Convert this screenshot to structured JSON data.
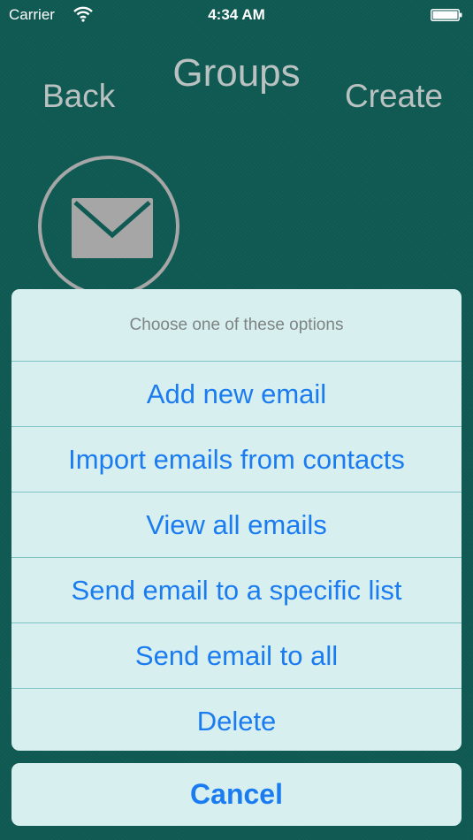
{
  "status_bar": {
    "carrier": "Carrier",
    "time": "4:34 AM",
    "wifi_icon": "wifi-icon",
    "battery_icon": "battery-icon"
  },
  "nav": {
    "back_label": "Back",
    "title": "Groups",
    "create_label": "Create"
  },
  "content": {
    "mail_icon": "envelope-icon"
  },
  "action_sheet": {
    "header": "Choose one of these options",
    "options": [
      "Add new email",
      "Import emails from contacts",
      "View all emails",
      "Send email to a specific list",
      "Send email to all",
      "Delete"
    ],
    "cancel_label": "Cancel"
  },
  "colors": {
    "background": "#0f5a53",
    "sheet": "#d8efef",
    "accent": "#1a7cf0",
    "nav_text": "#b9c2c0",
    "icon_gray": "#a6a6a6"
  }
}
